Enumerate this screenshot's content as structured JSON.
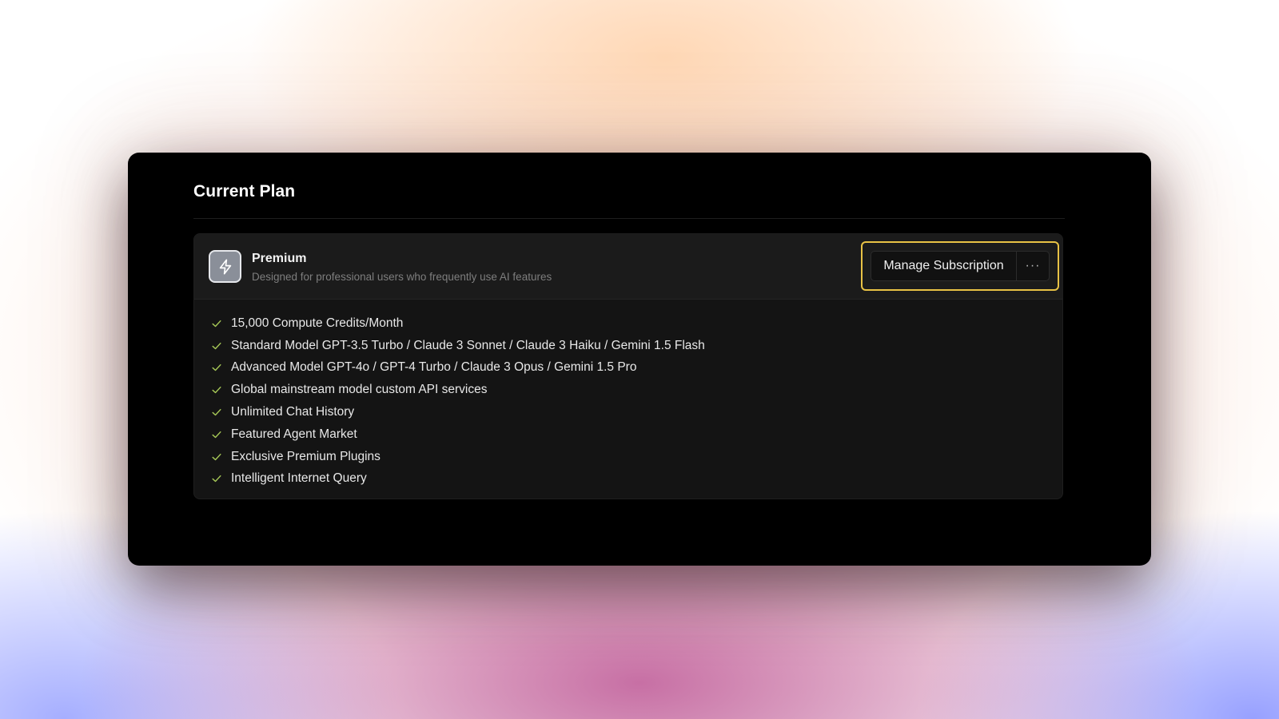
{
  "section": {
    "title": "Current Plan"
  },
  "plan": {
    "icon": "lightning-bolt-icon",
    "name": "Premium",
    "description": "Designed for professional users who frequently use AI features",
    "manage_label": "Manage Subscription",
    "more_label": "···"
  },
  "features": [
    "15,000 Compute Credits/Month",
    "Standard Model GPT-3.5 Turbo / Claude 3 Sonnet / Claude 3 Haiku / Gemini 1.5 Flash",
    "Advanced Model GPT-4o / GPT-4 Turbo / Claude 3 Opus / Gemini 1.5 Pro",
    "Global mainstream model custom API services",
    "Unlimited Chat History",
    "Featured Agent Market",
    "Exclusive Premium Plugins",
    "Intelligent Internet Query"
  ],
  "colors": {
    "accent_highlight": "#e8c245",
    "check": "#a7c957",
    "card_bg": "#141414",
    "window_bg": "#000000"
  }
}
